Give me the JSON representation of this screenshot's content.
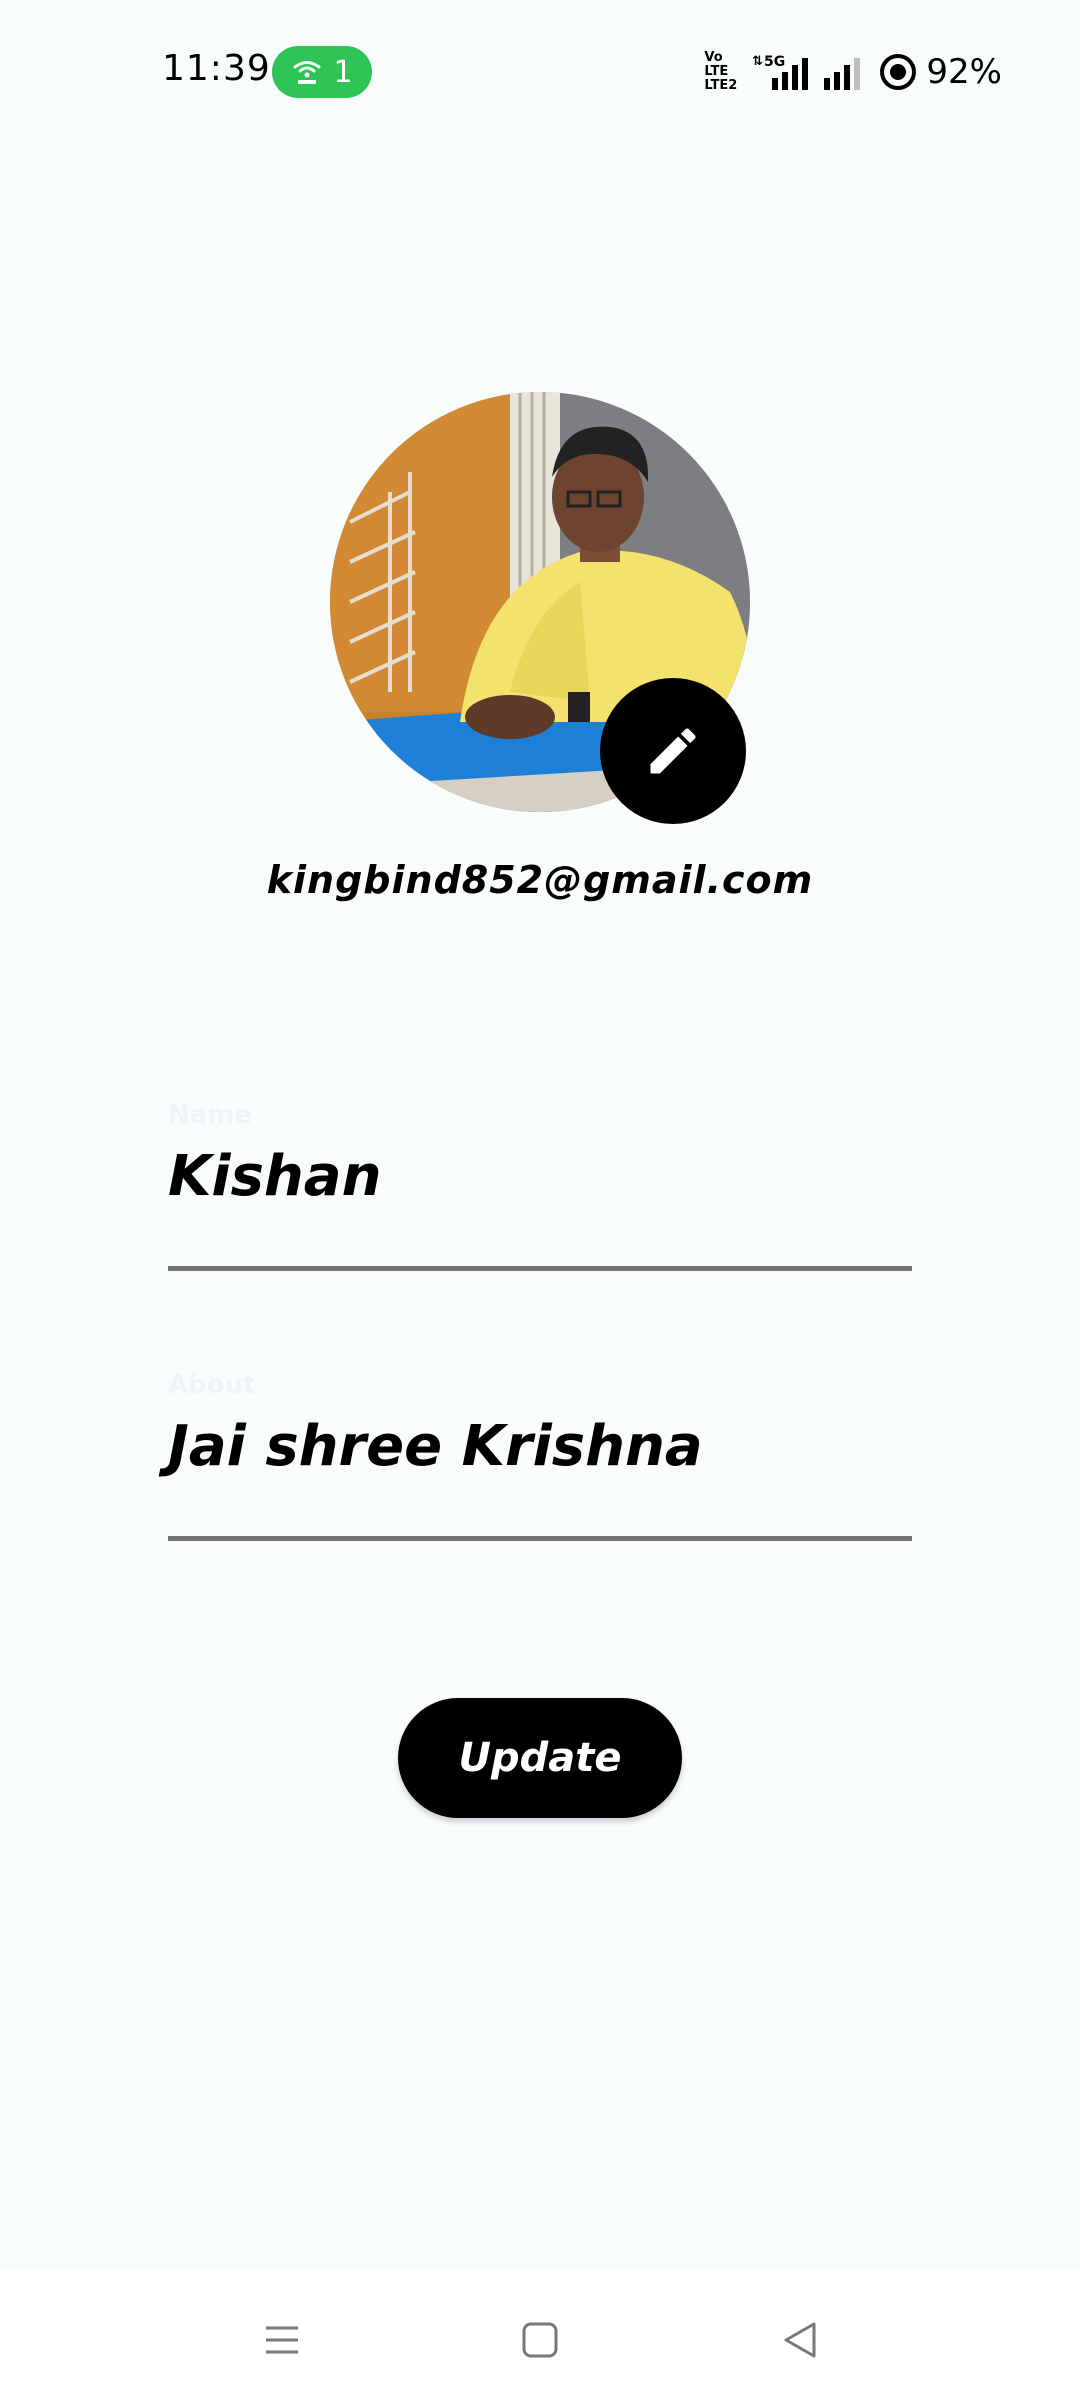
{
  "status_bar": {
    "time": "11:39",
    "hotspot_count": "1",
    "network_badge": "Vo LTE",
    "network_badge_sub": "LTE2",
    "network_type": "5G",
    "battery_text": "92%",
    "icons": [
      "hotspot-icon",
      "volte-icon",
      "signal-5g-icon",
      "signal-icon",
      "battery-saver-icon"
    ]
  },
  "profile": {
    "email": "kingbind852@gmail.com"
  },
  "form": {
    "name_label": "Name",
    "name_value": "Kishan",
    "about_label": "About",
    "about_value": "Jai shree Krishna",
    "update_label": "Update"
  },
  "nav": {
    "icons": [
      "menu-icon",
      "home-icon",
      "back-icon"
    ]
  },
  "colors": {
    "background": "#f8fcfd",
    "hotspot_pill": "#2fc456",
    "button": "#000000",
    "underline": "#737373"
  }
}
